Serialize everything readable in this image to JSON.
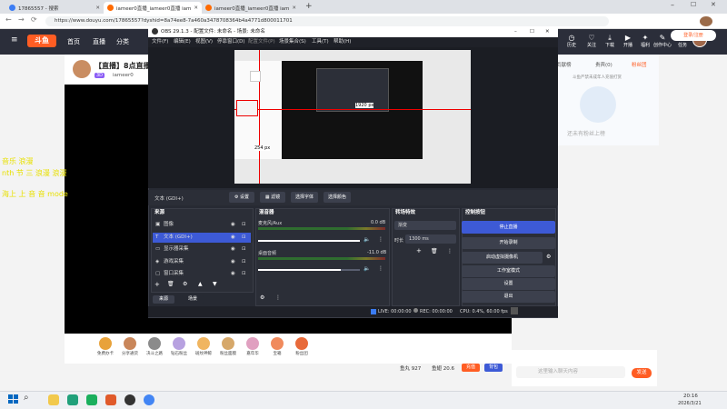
{
  "browser": {
    "tabs": [
      {
        "label": "17865557 - 搜索"
      },
      {
        "label": "iameer0直播_iameer0直播 iam"
      },
      {
        "label": "iameer0直播_iameer0直播 iam"
      }
    ],
    "url": "https://www.douyu.com/17865557?dyshid=8a74ee8-7a460a3478708364b4a4771d800011701"
  },
  "douyu": {
    "nav": [
      "首页",
      "直播",
      "分类"
    ],
    "header_icons": [
      "历史",
      "关注",
      "下载",
      "开播",
      "福利",
      "创作中心",
      "任务"
    ],
    "stream_title": "【直播】8点直播选",
    "streamer": "iameer0",
    "level": "3D",
    "overlay_lines": [
      "音乐 浪漫",
      "nth 节 三 浪漫 浪漫",
      "海上 上 音 音 mode"
    ],
    "right_tabs": [
      "贡献榜",
      "贵宾(0)",
      "粉丝团"
    ],
    "right_note": "斗鱼严禁未成年人充值打赏",
    "right_empty": "还未有粉丝上榜",
    "gifts": [
      {
        "label": "免费办卡"
      },
      {
        "label": "分享通货"
      },
      {
        "label": "决斗之路"
      },
      {
        "label": "钻石粉丝"
      },
      {
        "label": "斑纹神鲸"
      },
      {
        "label": "粉丝面膜"
      },
      {
        "label": "嘉年华"
      },
      {
        "label": "宝箱"
      },
      {
        "label": "粉丝团"
      }
    ],
    "stats": {
      "yuwan": "鱼丸 927",
      "yuchi": "鱼翅 20.6",
      "recharge": "充值",
      "bag": "背包"
    },
    "chat_placeholder": "这里输入聊天内容",
    "send": "发送",
    "login_btn": "登录/注册"
  },
  "obs": {
    "title": "OBS 29.1.3 - 配置文件: 未命名 - 场景: 未命名",
    "menu": [
      "文件(F)",
      "编辑(E)",
      "视图(V)",
      "停靠窗口(D)",
      "配置文件(P)",
      "场景集合(S)",
      "工具(T)",
      "帮助(H)"
    ],
    "preview_label_w": "1920 px",
    "preview_label_h": "254 px",
    "source_toolbar": {
      "selected": "文本 (GDI+)",
      "settings": "设置",
      "filters": "滤镜",
      "font": "选择字体",
      "color": "选择颜色"
    },
    "sources_title": "来源",
    "sources": [
      {
        "name": "图像"
      },
      {
        "name": "文本 (GDI+)"
      },
      {
        "name": "显示器采集"
      },
      {
        "name": "游戏采集"
      },
      {
        "name": "窗口采集"
      }
    ],
    "scene_tabs": [
      "来源",
      "场景"
    ],
    "mixer_title": "混音器",
    "mixer": [
      {
        "name": "麦克风/Aux",
        "db": "0.0 dB"
      },
      {
        "name": "桌面音频",
        "db": "-11.0 dB"
      }
    ],
    "mixer_scale": [
      "-60",
      "-55",
      "-50",
      "-45",
      "-40",
      "-35",
      "-30",
      "-25",
      "-20",
      "-15",
      "-10",
      "-5",
      "0"
    ],
    "transitions_title": "转场特效",
    "transition": "渐变",
    "duration_label": "时长",
    "duration": "1300 ms",
    "controls_title": "控制按钮",
    "controls": [
      "停止直播",
      "开始录制",
      "启动虚拟摄像机",
      "工作室模式",
      "设置",
      "退出"
    ],
    "status": {
      "live": "LIVE: 00:00:00",
      "rec": "REC: 00:00:00",
      "cpu": "CPU: 0.4%, 60.00 fps"
    }
  },
  "taskbar": {
    "time": "20:16",
    "date": "2026/3/21"
  },
  "colors": {
    "douyu_header": "#2b2e3a",
    "obs_bg": "#272a33",
    "accent_blue": "#3d5ad6",
    "douyu_orange": "#ff5d23"
  }
}
